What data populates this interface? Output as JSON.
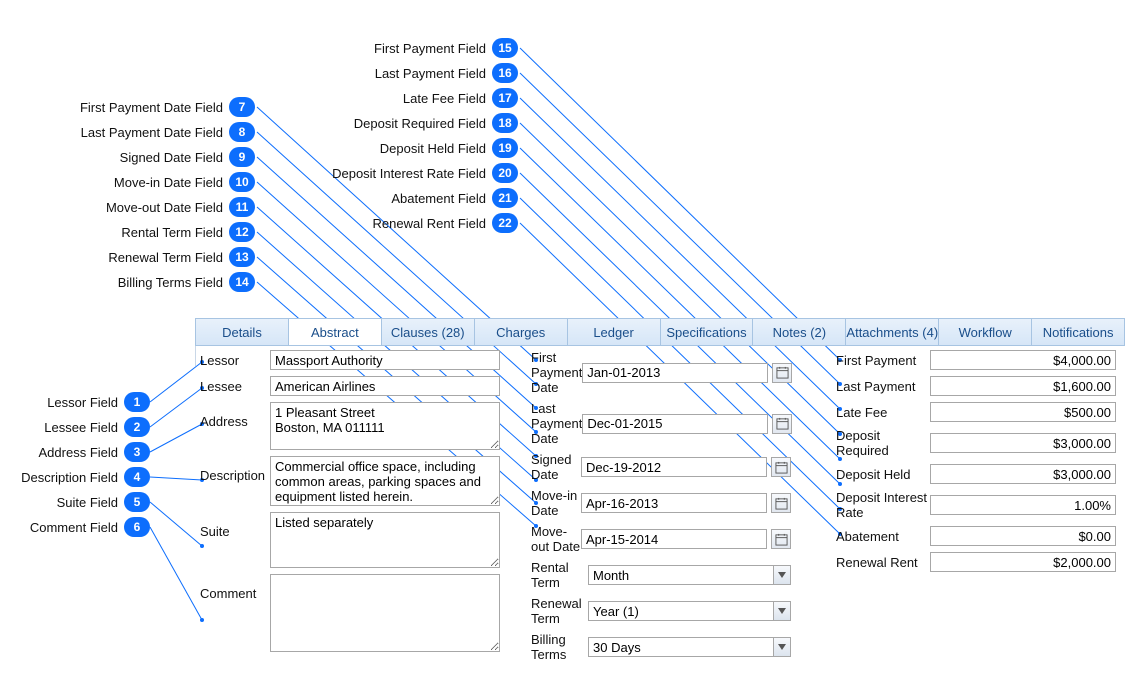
{
  "callouts_left": [
    {
      "n": "1",
      "label": "Lessor Field"
    },
    {
      "n": "2",
      "label": "Lessee Field"
    },
    {
      "n": "3",
      "label": "Address Field"
    },
    {
      "n": "4",
      "label": "Description Field"
    },
    {
      "n": "5",
      "label": "Suite Field"
    },
    {
      "n": "6",
      "label": "Comment Field"
    }
  ],
  "callouts_mid": [
    {
      "n": "7",
      "label": "First Payment Date Field"
    },
    {
      "n": "8",
      "label": "Last Payment Date Field"
    },
    {
      "n": "9",
      "label": "Signed Date Field"
    },
    {
      "n": "10",
      "label": "Move-in Date Field"
    },
    {
      "n": "11",
      "label": "Move-out Date Field"
    },
    {
      "n": "12",
      "label": "Rental Term Field"
    },
    {
      "n": "13",
      "label": "Renewal Term Field"
    },
    {
      "n": "14",
      "label": "Billing Terms Field"
    }
  ],
  "callouts_right": [
    {
      "n": "15",
      "label": "First Payment Field"
    },
    {
      "n": "16",
      "label": "Last Payment Field"
    },
    {
      "n": "17",
      "label": "Late Fee Field"
    },
    {
      "n": "18",
      "label": "Deposit Required Field"
    },
    {
      "n": "19",
      "label": "Deposit Held Field"
    },
    {
      "n": "20",
      "label": "Deposit Interest Rate Field"
    },
    {
      "n": "21",
      "label": "Abatement Field"
    },
    {
      "n": "22",
      "label": "Renewal Rent Field"
    }
  ],
  "tabs": [
    "Details",
    "Abstract",
    "Clauses (28)",
    "Charges",
    "Ledger",
    "Specifications",
    "Notes (2)",
    "Attachments (4)",
    "Workflow",
    "Notifications"
  ],
  "labels": {
    "lessor": "Lessor",
    "lessee": "Lessee",
    "address": "Address",
    "description": "Description",
    "suite": "Suite",
    "comment": "Comment",
    "firstPaymentDate": "First Payment Date",
    "lastPaymentDate": "Last Payment Date",
    "signedDate": "Signed Date",
    "moveInDate": "Move-in Date",
    "moveOutDate": "Move-out Date",
    "rentalTerm": "Rental Term",
    "renewalTerm": "Renewal Term",
    "billingTerms": "Billing Terms",
    "firstPayment": "First Payment",
    "lastPayment": "Last Payment",
    "lateFee": "Late Fee",
    "depositRequired": "Deposit Required",
    "depositHeld": "Deposit Held",
    "depositInterestRate": "Deposit Interest Rate",
    "abatement": "Abatement",
    "renewalRent": "Renewal Rent"
  },
  "values": {
    "lessor": "Massport Authority",
    "lessee": "American Airlines",
    "address": "1 Pleasant Street\nBoston, MA 011111",
    "description": "Commercial office space, including common areas, parking spaces and equipment listed herein.",
    "suite": "Listed separately",
    "comment": "",
    "firstPaymentDate": "Jan-01-2013",
    "lastPaymentDate": "Dec-01-2015",
    "signedDate": "Dec-19-2012",
    "moveInDate": "Apr-16-2013",
    "moveOutDate": "Apr-15-2014",
    "rentalTerm": "Month",
    "renewalTerm": "Year (1)",
    "billingTerms": "30 Days",
    "firstPayment": "$4,000.00",
    "lastPayment": "$1,600.00",
    "lateFee": "$500.00",
    "depositRequired": "$3,000.00",
    "depositHeld": "$3,000.00",
    "depositInterestRate": "1.00%",
    "abatement": "$0.00",
    "renewalRent": "$2,000.00"
  }
}
